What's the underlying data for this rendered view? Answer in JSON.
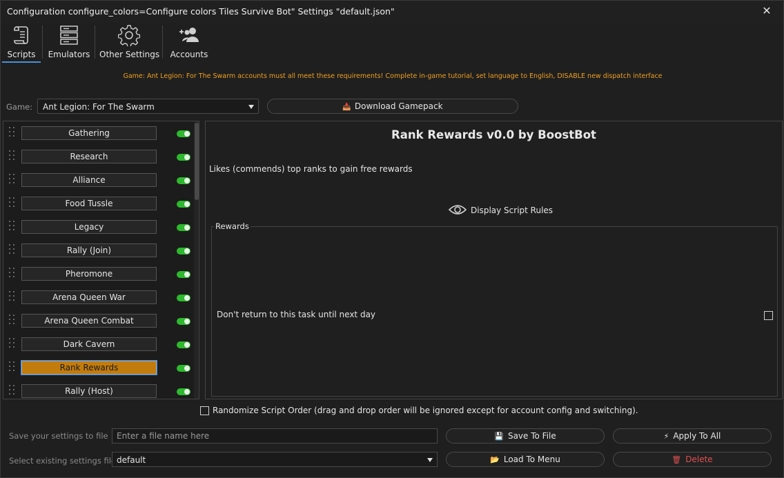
{
  "window": {
    "title": "Configuration configure_colors=Configure colors Tiles Survive Bot\" Settings \"default.json\"",
    "close_glyph": "✕"
  },
  "toolbar": {
    "tabs": [
      {
        "label": "Scripts",
        "icon": "scroll-icon",
        "active": true
      },
      {
        "label": "Emulators",
        "icon": "server-icon",
        "active": false
      },
      {
        "label": "Other Settings",
        "icon": "gear-icon",
        "active": false
      },
      {
        "label": "Accounts",
        "icon": "add-users-icon",
        "active": false
      }
    ]
  },
  "notice": "Game: Ant Legion: For The Swarm accounts must all meet these requirements! Complete in-game tutorial, set language to English, DISABLE new dispatch interface",
  "game": {
    "label": "Game:",
    "selected": "Ant Legion: For The Swarm",
    "download_label": "Download Gamepack",
    "download_icon": "📥"
  },
  "scripts": [
    {
      "label": "Gathering",
      "enabled": true,
      "selected": false
    },
    {
      "label": "Research",
      "enabled": true,
      "selected": false
    },
    {
      "label": "Alliance",
      "enabled": true,
      "selected": false
    },
    {
      "label": "Food Tussle",
      "enabled": true,
      "selected": false
    },
    {
      "label": "Legacy",
      "enabled": true,
      "selected": false
    },
    {
      "label": "Rally (Join)",
      "enabled": true,
      "selected": false
    },
    {
      "label": "Pheromone",
      "enabled": true,
      "selected": false
    },
    {
      "label": "Arena Queen War",
      "enabled": true,
      "selected": false
    },
    {
      "label": "Arena Queen Combat",
      "enabled": true,
      "selected": false
    },
    {
      "label": "Dark Cavern",
      "enabled": true,
      "selected": false
    },
    {
      "label": "Rank Rewards",
      "enabled": true,
      "selected": true
    },
    {
      "label": "Rally (Host)",
      "enabled": true,
      "selected": false
    }
  ],
  "detail": {
    "title": "Rank Rewards v0.0 by BoostBot",
    "description": "Likes (commends) top ranks to gain free rewards",
    "rules_link": "Display Script Rules",
    "group_title": "Rewards",
    "option_label": "Don't return to this task until next day",
    "option_checked": false
  },
  "randomize": {
    "label": "Randomize Script Order (drag and drop order will be ignored except for account config and switching).",
    "checked": false
  },
  "save": {
    "label": "Save your settings to file",
    "placeholder": "Enter a file name here",
    "value": "",
    "save_button": "Save To File",
    "save_icon": "💾",
    "apply_button": "Apply To All",
    "apply_icon": "⚡"
  },
  "load": {
    "label": "Select existing settings file",
    "selected": "default",
    "load_button": "Load To Menu",
    "load_icon": "📂",
    "delete_button": "Delete",
    "delete_icon": "🗑"
  },
  "colors": {
    "accent": "#4a90d9",
    "warning": "#f0a020",
    "selected_script": "#c27c0e",
    "toggle_on": "#2eb82e",
    "danger": "#e05050"
  }
}
